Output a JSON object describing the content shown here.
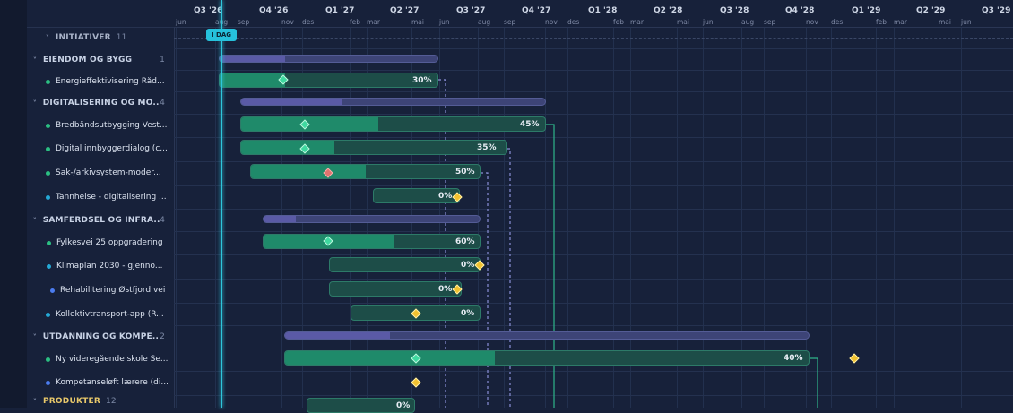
{
  "header": {
    "quarters": [
      "Q3 '26",
      "Q4 '26",
      "Q1 '27",
      "Q2 '27",
      "Q3 '27",
      "Q4 '27",
      "Q1 '28",
      "Q2 '28",
      "Q3 '28",
      "Q4 '28",
      "Q1 '29",
      "Q2 '29",
      "Q3 '29"
    ],
    "months": [
      "jun",
      "aug",
      "sep",
      "nov",
      "des",
      "feb",
      "mar",
      "mai",
      "jun",
      "aug",
      "sep",
      "nov",
      "des",
      "feb",
      "mar",
      "mai",
      "jun",
      "aug",
      "sep",
      "nov",
      "des",
      "feb",
      "mar",
      "mai",
      "jun"
    ],
    "today_label": "I DAG"
  },
  "sidebar": {
    "rows": [
      {
        "kind": "top",
        "label": "INITIATIVER",
        "count": "11"
      },
      {
        "kind": "group",
        "label": "EIENDOM OG BYGG",
        "count": "1"
      },
      {
        "kind": "item",
        "label": "Energieffektivisering Råd...",
        "dot": "#2bbf82"
      },
      {
        "kind": "group",
        "label": "DIGITALISERING OG MO...",
        "count": "4"
      },
      {
        "kind": "item",
        "label": "Bredbåndsutbygging Vest...",
        "dot": "#2bbf82"
      },
      {
        "kind": "item",
        "label": "Digital innbyggerdialog (c...",
        "dot": "#2bbf82"
      },
      {
        "kind": "item",
        "label": "Sak-/arkivsystem-moder...",
        "dot": "#2bbf82"
      },
      {
        "kind": "item",
        "label": "Tannhelse - digitalisering ...",
        "dot": "#25a9d6"
      },
      {
        "kind": "group",
        "label": "SAMFERDSEL OG INFRA...",
        "count": "4"
      },
      {
        "kind": "item",
        "label": "Fylkesvei 25 oppgradering",
        "dot": "#2bbf82"
      },
      {
        "kind": "item",
        "label": "Klimaplan 2030 - gjenno...",
        "dot": "#25a9d6"
      },
      {
        "kind": "item",
        "label": "Rehabilitering Østfjord vei",
        "dot": "#4b7cf0"
      },
      {
        "kind": "item",
        "label": "Kollektivtransport-app (R...",
        "dot": "#25a9d6"
      },
      {
        "kind": "group",
        "label": "UTDANNING OG KOMPE...",
        "count": "2"
      },
      {
        "kind": "item",
        "label": "Ny videregående skole Se...",
        "dot": "#2bbf82"
      },
      {
        "kind": "item",
        "label": "Kompetanseløft lærere (di...",
        "dot": "#4b7cf0"
      },
      {
        "kind": "partial",
        "label": "PRODUKTER",
        "count": "12"
      }
    ]
  },
  "tasks": [
    {
      "pct": "30%",
      "progress": 0.3,
      "milestone": "green"
    },
    {
      "pct": "45%",
      "progress": 0.45,
      "milestone": "green"
    },
    {
      "pct": "35%",
      "progress": 0.35,
      "milestone": "green"
    },
    {
      "pct": "50%",
      "progress": 0.5,
      "milestone": "red"
    },
    {
      "pct": "0%",
      "progress": 0,
      "milestone": "yellow"
    },
    {
      "pct": "60%",
      "progress": 0.6,
      "milestone": "green"
    },
    {
      "pct": "0%",
      "progress": 0,
      "milestone": "yellow"
    },
    {
      "pct": "0%",
      "progress": 0,
      "milestone": "yellow"
    },
    {
      "pct": "0%",
      "progress": 0,
      "milestone": "yellow"
    },
    {
      "pct": "40%",
      "progress": 0.4,
      "milestone": "green"
    },
    {
      "pct": "0%",
      "progress": 0,
      "milestone": "yellow"
    }
  ],
  "colors": {
    "today": "#2fc6dc",
    "task_fill": "#1f8a6a",
    "group_bar": "#5a5aa6",
    "milestone_green": "#3fd9a0",
    "milestone_yellow": "#f2c230",
    "milestone_red": "#e0736f"
  }
}
